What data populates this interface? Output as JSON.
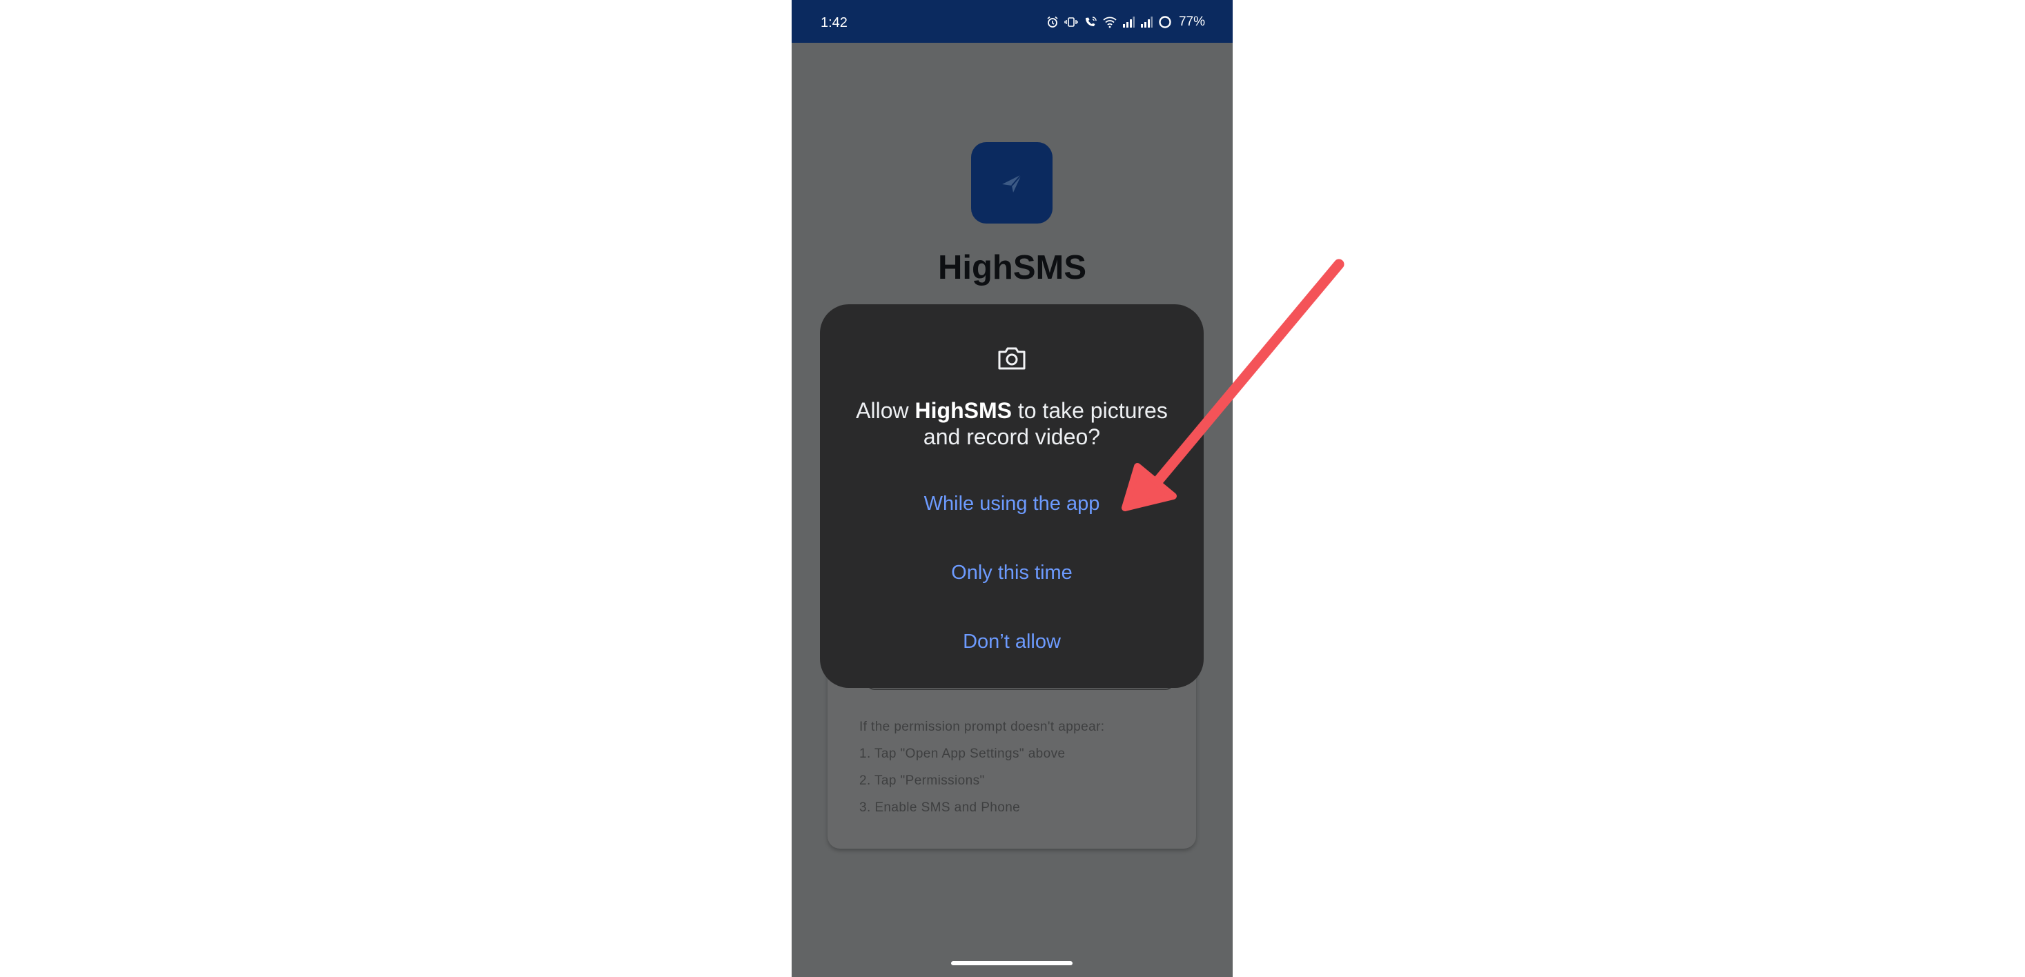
{
  "status_bar": {
    "time": "1:42",
    "battery": "77%",
    "icons": [
      "alarm-icon",
      "vibrate-icon",
      "wifi-calling-icon",
      "wifi-icon",
      "signal-icon",
      "signal-icon",
      "battery-saver-icon"
    ]
  },
  "app": {
    "name": "HighSMS",
    "icon": "send-icon"
  },
  "background_card": {
    "help_lines": [
      "If the permission prompt doesn't appear:",
      "1. Tap \"Open App Settings\" above",
      "2. Tap \"Permissions\"",
      "3. Enable SMS and Phone"
    ]
  },
  "permission_dialog": {
    "icon": "camera-icon",
    "message_prefix": "Allow ",
    "message_app": "HighSMS",
    "message_suffix": " to take pictures and record video?",
    "buttons": {
      "while_using": "While using the app",
      "only_this_time": "Only this time",
      "dont_allow": "Don’t allow"
    }
  },
  "colors": {
    "status_bar_bg": "#0b2a5f",
    "scrim": "#626465",
    "dialog_bg": "#2a2a2b",
    "dialog_button_text": "#6d9bff",
    "annotation_arrow": "#f45358"
  }
}
